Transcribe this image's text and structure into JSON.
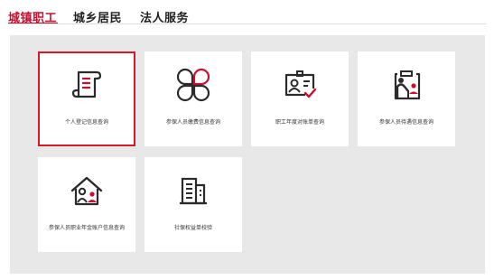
{
  "tabs": [
    {
      "label": "城镇职工",
      "active": true
    },
    {
      "label": "城乡居民",
      "active": false
    },
    {
      "label": "法人服务",
      "active": false
    }
  ],
  "services": [
    {
      "label": "个人登记信息查询",
      "icon": "scroll-document-icon",
      "selected": true
    },
    {
      "label": "参保人员缴费信息查询",
      "icon": "four-petal-icon",
      "selected": false
    },
    {
      "label": "职工年度对账单查询",
      "icon": "id-card-check-icon",
      "selected": false
    },
    {
      "label": "参保人员待遇信息查询",
      "icon": "elderly-person-clipboard-icon",
      "selected": false
    },
    {
      "label": "参保人员职业年金账户信息查询",
      "icon": "house-family-icon",
      "selected": false
    },
    {
      "label": "社保权益单校验",
      "icon": "buildings-icon",
      "selected": false
    }
  ],
  "colors": {
    "accent": "#c8102e",
    "selected_border": "#d71a2a",
    "icon_dark": "#2b2b2b",
    "panel_bg": "#e8e8e8"
  }
}
